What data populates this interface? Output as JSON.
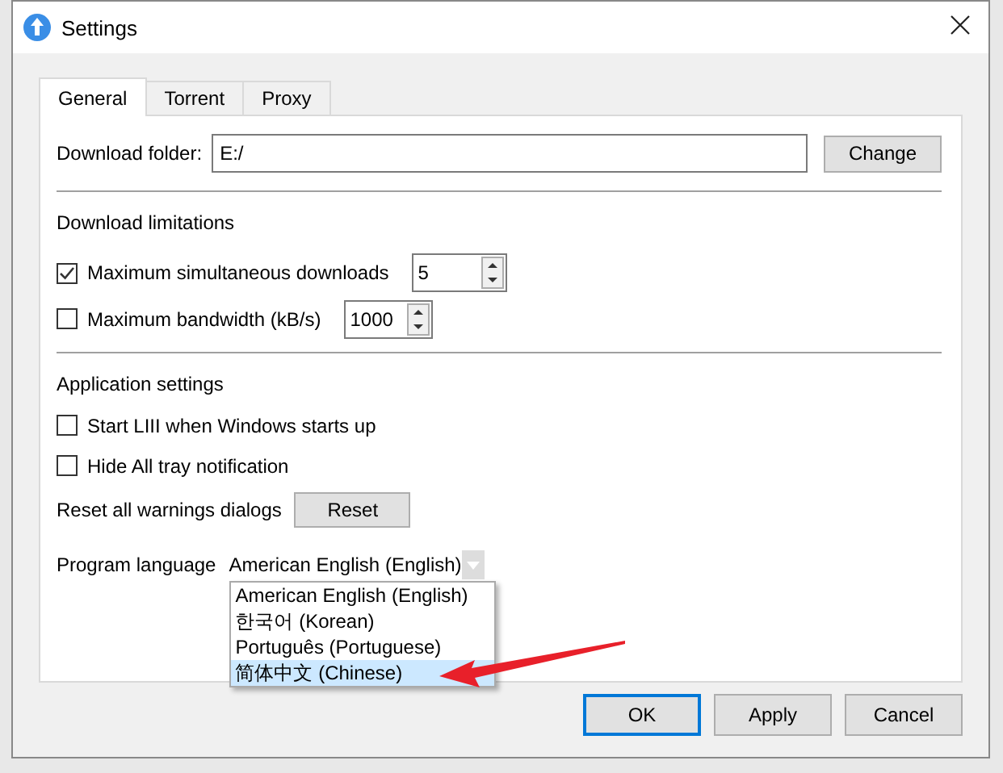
{
  "window": {
    "title": "Settings"
  },
  "tabs": [
    {
      "label": "General",
      "selected": true
    },
    {
      "label": "Torrent",
      "selected": false
    },
    {
      "label": "Proxy",
      "selected": false
    }
  ],
  "download_folder": {
    "label": "Download folder:",
    "value": "E:/",
    "button": "Change"
  },
  "download_limitations": {
    "heading": "Download limitations",
    "rows": [
      {
        "label": "Maximum simultaneous downloads",
        "checked": true,
        "value": "5"
      },
      {
        "label": "Maximum bandwidth (kB/s)",
        "checked": false,
        "value": "1000"
      }
    ]
  },
  "application_settings": {
    "heading": "Application settings",
    "checkboxes": [
      {
        "label": "Start LIII when Windows starts up",
        "checked": false
      },
      {
        "label": "Hide All tray notification",
        "checked": false
      }
    ],
    "reset": {
      "label": "Reset all warnings dialogs",
      "button": "Reset"
    },
    "language": {
      "label": "Program language",
      "value": "American English (English)",
      "options": [
        {
          "label": "American English (English)",
          "highlighted": false
        },
        {
          "label": "한국어 (Korean)",
          "highlighted": false
        },
        {
          "label": "Português (Portuguese)",
          "highlighted": false
        },
        {
          "label": "简体中文 (Chinese)",
          "highlighted": true
        }
      ]
    }
  },
  "buttons": [
    {
      "label": "OK",
      "default": true
    },
    {
      "label": "Apply",
      "default": false
    },
    {
      "label": "Cancel",
      "default": false
    }
  ]
}
